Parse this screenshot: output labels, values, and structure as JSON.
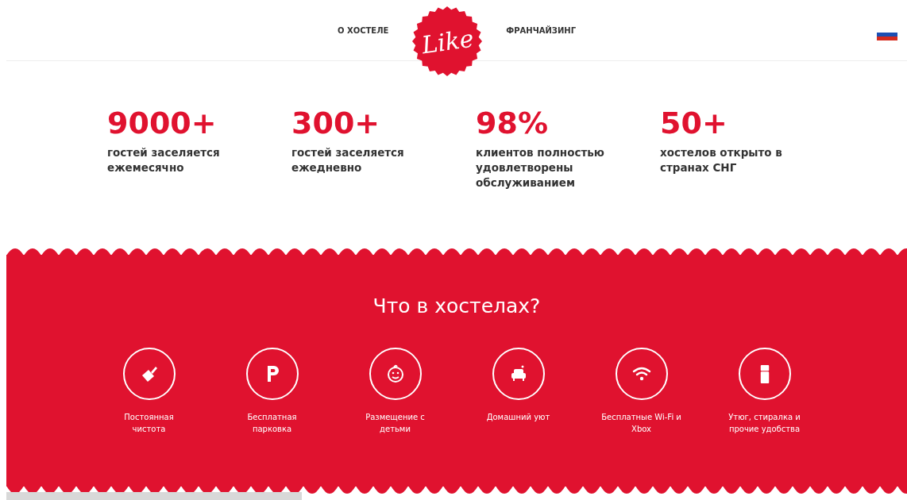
{
  "nav": {
    "left_link": "О ХОСТЕЛЕ",
    "logo": "Like",
    "right_link": "ФРАНЧАЙЗИНГ"
  },
  "stats": [
    {
      "value": "9000+",
      "caption": "гостей заселяется ежемесячно"
    },
    {
      "value": "300+",
      "caption": "гостей заселяется ежедневно"
    },
    {
      "value": "98%",
      "caption": "клиентов полностью удовлетворены обслуживанием"
    },
    {
      "value": "50+",
      "caption": "хостелов открыто в странах СНГ"
    }
  ],
  "features": {
    "title": "Что в хостелах?",
    "items": [
      {
        "kind": "cleaning",
        "label": "Постоянная чистота"
      },
      {
        "kind": "parking",
        "label": "Бесплатная парковка"
      },
      {
        "kind": "kids",
        "label": "Размещение с детьми"
      },
      {
        "kind": "comfort",
        "label": "Домашний уют"
      },
      {
        "kind": "wifi",
        "label": "Бесплатные Wi-Fi и Xbox"
      },
      {
        "kind": "appliances",
        "label": "Утюг, стиралка и прочие удобства"
      }
    ]
  }
}
